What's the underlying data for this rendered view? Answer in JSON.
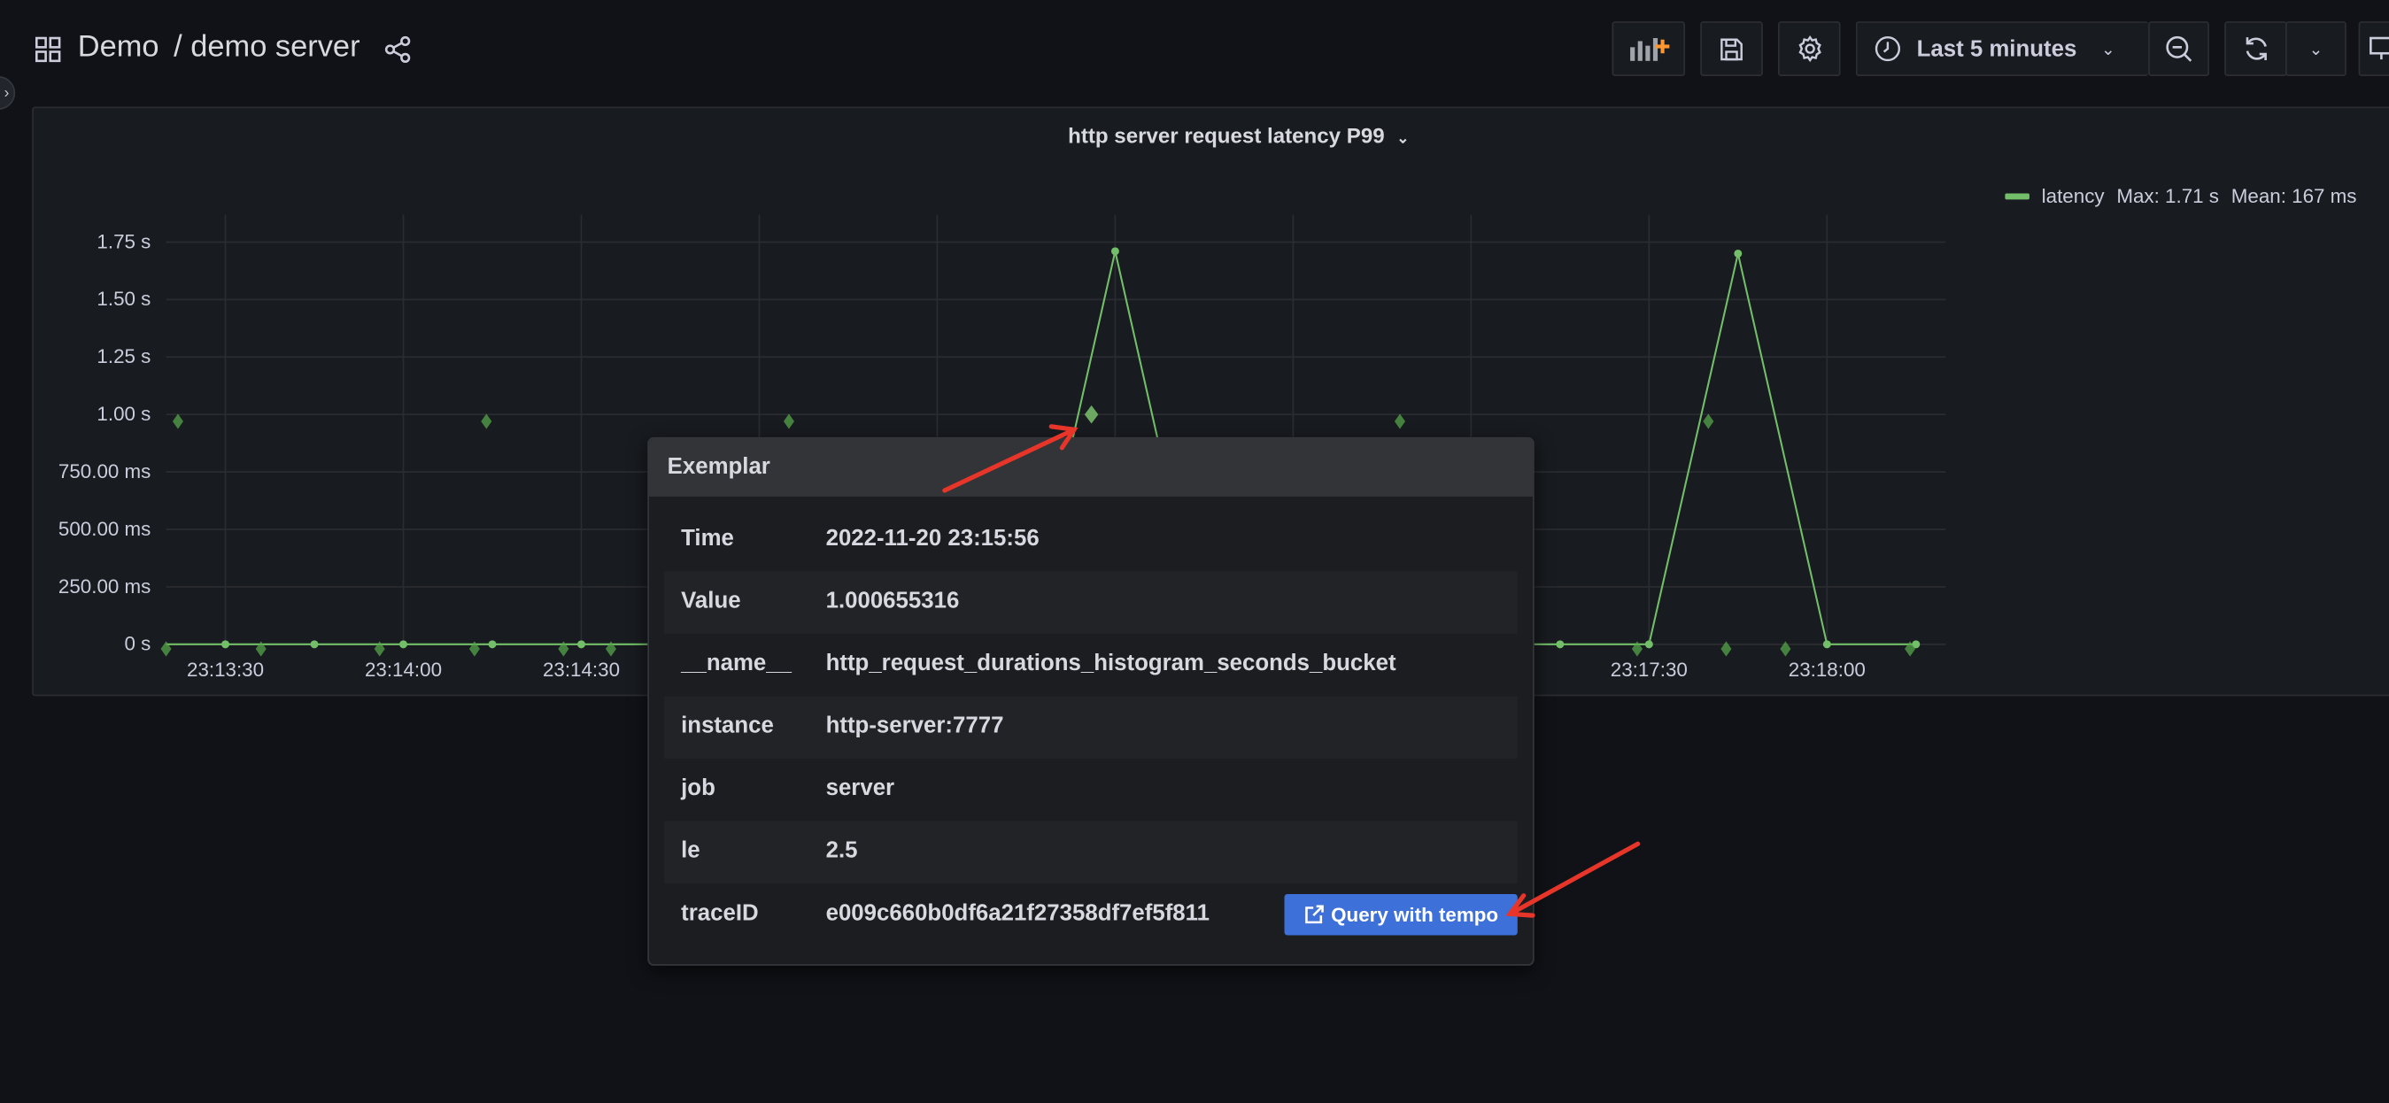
{
  "header": {
    "folder": "Demo",
    "dashboard": "/ demo server"
  },
  "toolbar": {
    "time_range": "Last 5 minutes"
  },
  "panel": {
    "title": "http server request latency P99"
  },
  "legend": {
    "series": "latency",
    "max": "Max: 1.71 s",
    "mean": "Mean: 167 ms",
    "color": "#73bf69"
  },
  "exemplar": {
    "title": "Exemplar",
    "rows": [
      {
        "key": "Time",
        "value": "2022-11-20 23:15:56"
      },
      {
        "key": "Value",
        "value": "1.000655316"
      },
      {
        "key": "__name__",
        "value": "http_request_durations_histogram_seconds_bucket"
      },
      {
        "key": "instance",
        "value": "http-server:7777"
      },
      {
        "key": "job",
        "value": "server"
      },
      {
        "key": "le",
        "value": "2.5"
      },
      {
        "key": "traceID",
        "value": "e009c660b0df6a21f27358df7ef5f811"
      }
    ],
    "action_label": "Query with tempo"
  },
  "chart_data": {
    "type": "line",
    "title": "http server request latency P99",
    "xlim": [
      "23:13:20",
      "23:18:20"
    ],
    "ylim": [
      0,
      1.87
    ],
    "y_ticks": [
      {
        "v": 0,
        "label": "0 s"
      },
      {
        "v": 0.25,
        "label": "250.00 ms"
      },
      {
        "v": 0.5,
        "label": "500.00 ms"
      },
      {
        "v": 0.75,
        "label": "750.00 ms"
      },
      {
        "v": 1.0,
        "label": "1.00 s"
      },
      {
        "v": 1.25,
        "label": "1.25 s"
      },
      {
        "v": 1.5,
        "label": "1.50 s"
      },
      {
        "v": 1.75,
        "label": "1.75 s"
      }
    ],
    "x_ticks": [
      "23:13:30",
      "23:14:00",
      "23:14:30",
      "23:15:00",
      "23:15:30",
      "23:16:00",
      "23:16:30",
      "23:17:00",
      "23:17:30",
      "23:18:00"
    ],
    "x_tick_labels_visible": [
      "23:13:30",
      "23:14:00",
      "23:14:30",
      "23:17:30",
      "23:18:00"
    ],
    "grid": true,
    "legend_position": "top-right",
    "series": [
      {
        "name": "latency",
        "color": "#73bf69",
        "x": [
          "23:13:20",
          "23:13:30",
          "23:13:45",
          "23:14:00",
          "23:14:15",
          "23:14:30",
          "23:14:45",
          "23:15:00",
          "23:15:15",
          "23:15:30",
          "23:15:45",
          "23:16:00",
          "23:16:15",
          "23:16:30",
          "23:16:45",
          "23:17:00",
          "23:17:15",
          "23:17:30",
          "23:17:45",
          "23:18:00",
          "23:18:15"
        ],
        "y": [
          0,
          0,
          0,
          0,
          0,
          0,
          0,
          0,
          0,
          0,
          0,
          1.71,
          0,
          0,
          0,
          0,
          0,
          0,
          1.7,
          0,
          0
        ]
      }
    ],
    "exemplars": {
      "color": "#56a64b",
      "x": [
        "23:13:22",
        "23:14:14",
        "23:15:05",
        "23:15:56",
        "23:16:48",
        "23:17:40",
        "23:13:20",
        "23:13:36",
        "23:13:56",
        "23:14:12",
        "23:14:27",
        "23:14:35",
        "23:17:28",
        "23:17:43",
        "23:17:53",
        "23:18:14"
      ],
      "y": [
        0.97,
        0.97,
        0.97,
        1.0,
        0.97,
        0.97,
        -0.02,
        -0.02,
        -0.02,
        -0.02,
        -0.02,
        -0.02,
        -0.02,
        -0.02,
        -0.02,
        -0.02
      ],
      "selected": "23:15:56"
    }
  }
}
